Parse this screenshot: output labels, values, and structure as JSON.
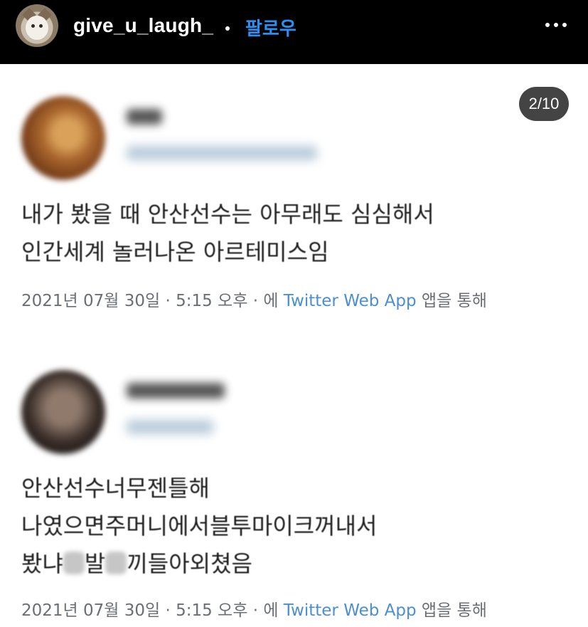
{
  "header": {
    "username": "give_u_laugh_",
    "follow_label": "팔로우",
    "more_icon": "more-horizontal-icon"
  },
  "carousel": {
    "counter": "2/10"
  },
  "tweets": [
    {
      "lines": [
        "내가 봤을 때 안산선수는 아무래도 심심해서",
        "인간세계 놀러나온 아르테미스임"
      ],
      "meta_prefix": "2021년 07월 30일 · 5:15 오후 · 에 ",
      "meta_app": "Twitter Web App",
      "meta_suffix": " 앱을 통해"
    },
    {
      "line1": "안산선수너무젠틀해",
      "line2": "나였으면주머니에서블투마이크꺼내서",
      "line3_a": "봤냐",
      "line3_b": "발",
      "line3_c": "끼들아외쳤음",
      "meta_prefix": "2021년 07월 30일 · 5:15 오후 · 에 ",
      "meta_app": "Twitter Web App",
      "meta_suffix": " 앱을 통해"
    }
  ],
  "colors": {
    "header_bg": "#000000",
    "follow": "#2f8ff0",
    "link": "#4b8fd1",
    "meta": "#6b6f74"
  }
}
